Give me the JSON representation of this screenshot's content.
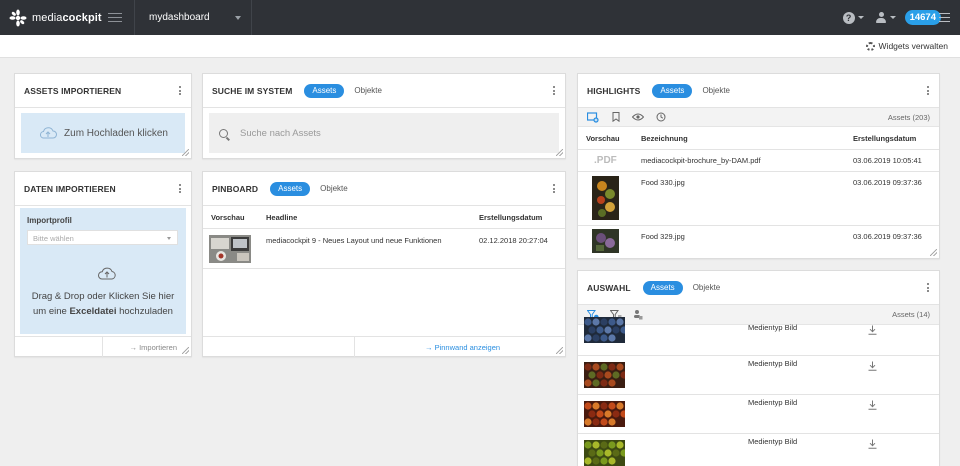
{
  "topbar": {
    "logo_left": "media",
    "logo_right": "cockpit",
    "dashboard_name": "mydashboard",
    "badge_count": "14674"
  },
  "subbar": {
    "widgets_label": "Widgets verwalten"
  },
  "assets_import": {
    "title": "ASSETS IMPORTIEREN",
    "upload_label": "Zum Hochladen klicken"
  },
  "data_import": {
    "title": "DATEN IMPORTIEREN",
    "profile_label": "Importprofil",
    "profile_placeholder": "Bitte wählen",
    "drop_line1": "Drag & Drop oder Klicken Sie hier",
    "drop_pre": "um eine ",
    "drop_bold": "Exceldatei",
    "drop_post": " hochzuladen",
    "import_button": "Importieren"
  },
  "search": {
    "title": "SUCHE IM SYSTEM",
    "tab_active": "Assets",
    "tab_inactive": "Objekte",
    "placeholder": "Suche nach Assets"
  },
  "pinboard": {
    "title": "PINBOARD",
    "tab_active": "Assets",
    "tab_inactive": "Objekte",
    "columns": [
      "Vorschau",
      "Headline",
      "Erstellungsdatum"
    ],
    "rows": [
      {
        "headline": "mediacockpit 9 - Neues Layout und neue Funktionen",
        "date": "02.12.2018 20:27:04"
      }
    ],
    "footer_button": "Pinnwand anzeigen"
  },
  "highlights": {
    "title": "HIGHLIGHTS",
    "tab_active": "Assets",
    "tab_inactive": "Objekte",
    "count": "Assets (203)",
    "columns": [
      "Vorschau",
      "Bezeichnung",
      "Erstellungsdatum"
    ],
    "rows": [
      {
        "preview": ".PDF",
        "name": "mediacockpit-brochure_by-DAM.pdf",
        "date": "03.06.2019 10:05:41"
      },
      {
        "preview": "",
        "name": "Food 330.jpg",
        "date": "03.06.2019 09:37:36"
      },
      {
        "preview": "",
        "name": "Food 329.jpg",
        "date": "03.06.2019 09:37:36"
      }
    ]
  },
  "auswahl": {
    "title": "AUSWAHL",
    "tab_active": "Assets",
    "tab_inactive": "Objekte",
    "count": "Assets (14)",
    "rows": [
      {
        "type": "Medientyp Bild"
      },
      {
        "type": "Medientyp Bild"
      },
      {
        "type": "Medientyp Bild"
      },
      {
        "type": "Medientyp Bild"
      }
    ]
  },
  "colors": {
    "accent": "#2a8ee0",
    "topbar": "#2f3237",
    "badge": "#2a9fe8",
    "drop_bg": "#d9e9f6"
  }
}
